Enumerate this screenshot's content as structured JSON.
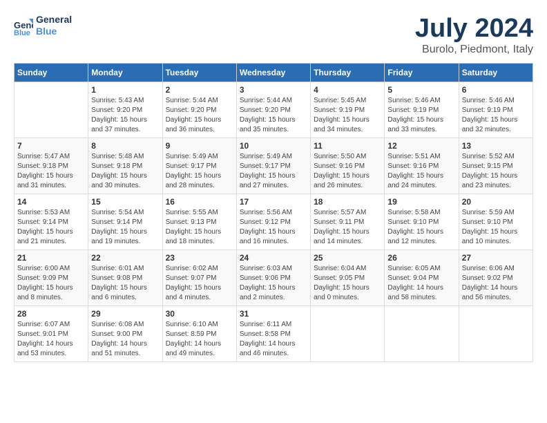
{
  "header": {
    "logo_line1": "General",
    "logo_line2": "Blue",
    "title": "July 2024",
    "subtitle": "Burolo, Piedmont, Italy"
  },
  "days_of_week": [
    "Sunday",
    "Monday",
    "Tuesday",
    "Wednesday",
    "Thursday",
    "Friday",
    "Saturday"
  ],
  "weeks": [
    [
      {
        "day": "",
        "info": ""
      },
      {
        "day": "1",
        "info": "Sunrise: 5:43 AM\nSunset: 9:20 PM\nDaylight: 15 hours\nand 37 minutes."
      },
      {
        "day": "2",
        "info": "Sunrise: 5:44 AM\nSunset: 9:20 PM\nDaylight: 15 hours\nand 36 minutes."
      },
      {
        "day": "3",
        "info": "Sunrise: 5:44 AM\nSunset: 9:20 PM\nDaylight: 15 hours\nand 35 minutes."
      },
      {
        "day": "4",
        "info": "Sunrise: 5:45 AM\nSunset: 9:19 PM\nDaylight: 15 hours\nand 34 minutes."
      },
      {
        "day": "5",
        "info": "Sunrise: 5:46 AM\nSunset: 9:19 PM\nDaylight: 15 hours\nand 33 minutes."
      },
      {
        "day": "6",
        "info": "Sunrise: 5:46 AM\nSunset: 9:19 PM\nDaylight: 15 hours\nand 32 minutes."
      }
    ],
    [
      {
        "day": "7",
        "info": "Sunrise: 5:47 AM\nSunset: 9:18 PM\nDaylight: 15 hours\nand 31 minutes."
      },
      {
        "day": "8",
        "info": "Sunrise: 5:48 AM\nSunset: 9:18 PM\nDaylight: 15 hours\nand 30 minutes."
      },
      {
        "day": "9",
        "info": "Sunrise: 5:49 AM\nSunset: 9:17 PM\nDaylight: 15 hours\nand 28 minutes."
      },
      {
        "day": "10",
        "info": "Sunrise: 5:49 AM\nSunset: 9:17 PM\nDaylight: 15 hours\nand 27 minutes."
      },
      {
        "day": "11",
        "info": "Sunrise: 5:50 AM\nSunset: 9:16 PM\nDaylight: 15 hours\nand 26 minutes."
      },
      {
        "day": "12",
        "info": "Sunrise: 5:51 AM\nSunset: 9:16 PM\nDaylight: 15 hours\nand 24 minutes."
      },
      {
        "day": "13",
        "info": "Sunrise: 5:52 AM\nSunset: 9:15 PM\nDaylight: 15 hours\nand 23 minutes."
      }
    ],
    [
      {
        "day": "14",
        "info": "Sunrise: 5:53 AM\nSunset: 9:14 PM\nDaylight: 15 hours\nand 21 minutes."
      },
      {
        "day": "15",
        "info": "Sunrise: 5:54 AM\nSunset: 9:14 PM\nDaylight: 15 hours\nand 19 minutes."
      },
      {
        "day": "16",
        "info": "Sunrise: 5:55 AM\nSunset: 9:13 PM\nDaylight: 15 hours\nand 18 minutes."
      },
      {
        "day": "17",
        "info": "Sunrise: 5:56 AM\nSunset: 9:12 PM\nDaylight: 15 hours\nand 16 minutes."
      },
      {
        "day": "18",
        "info": "Sunrise: 5:57 AM\nSunset: 9:11 PM\nDaylight: 15 hours\nand 14 minutes."
      },
      {
        "day": "19",
        "info": "Sunrise: 5:58 AM\nSunset: 9:10 PM\nDaylight: 15 hours\nand 12 minutes."
      },
      {
        "day": "20",
        "info": "Sunrise: 5:59 AM\nSunset: 9:10 PM\nDaylight: 15 hours\nand 10 minutes."
      }
    ],
    [
      {
        "day": "21",
        "info": "Sunrise: 6:00 AM\nSunset: 9:09 PM\nDaylight: 15 hours\nand 8 minutes."
      },
      {
        "day": "22",
        "info": "Sunrise: 6:01 AM\nSunset: 9:08 PM\nDaylight: 15 hours\nand 6 minutes."
      },
      {
        "day": "23",
        "info": "Sunrise: 6:02 AM\nSunset: 9:07 PM\nDaylight: 15 hours\nand 4 minutes."
      },
      {
        "day": "24",
        "info": "Sunrise: 6:03 AM\nSunset: 9:06 PM\nDaylight: 15 hours\nand 2 minutes."
      },
      {
        "day": "25",
        "info": "Sunrise: 6:04 AM\nSunset: 9:05 PM\nDaylight: 15 hours\nand 0 minutes."
      },
      {
        "day": "26",
        "info": "Sunrise: 6:05 AM\nSunset: 9:04 PM\nDaylight: 14 hours\nand 58 minutes."
      },
      {
        "day": "27",
        "info": "Sunrise: 6:06 AM\nSunset: 9:02 PM\nDaylight: 14 hours\nand 56 minutes."
      }
    ],
    [
      {
        "day": "28",
        "info": "Sunrise: 6:07 AM\nSunset: 9:01 PM\nDaylight: 14 hours\nand 53 minutes."
      },
      {
        "day": "29",
        "info": "Sunrise: 6:08 AM\nSunset: 9:00 PM\nDaylight: 14 hours\nand 51 minutes."
      },
      {
        "day": "30",
        "info": "Sunrise: 6:10 AM\nSunset: 8:59 PM\nDaylight: 14 hours\nand 49 minutes."
      },
      {
        "day": "31",
        "info": "Sunrise: 6:11 AM\nSunset: 8:58 PM\nDaylight: 14 hours\nand 46 minutes."
      },
      {
        "day": "",
        "info": ""
      },
      {
        "day": "",
        "info": ""
      },
      {
        "day": "",
        "info": ""
      }
    ]
  ]
}
